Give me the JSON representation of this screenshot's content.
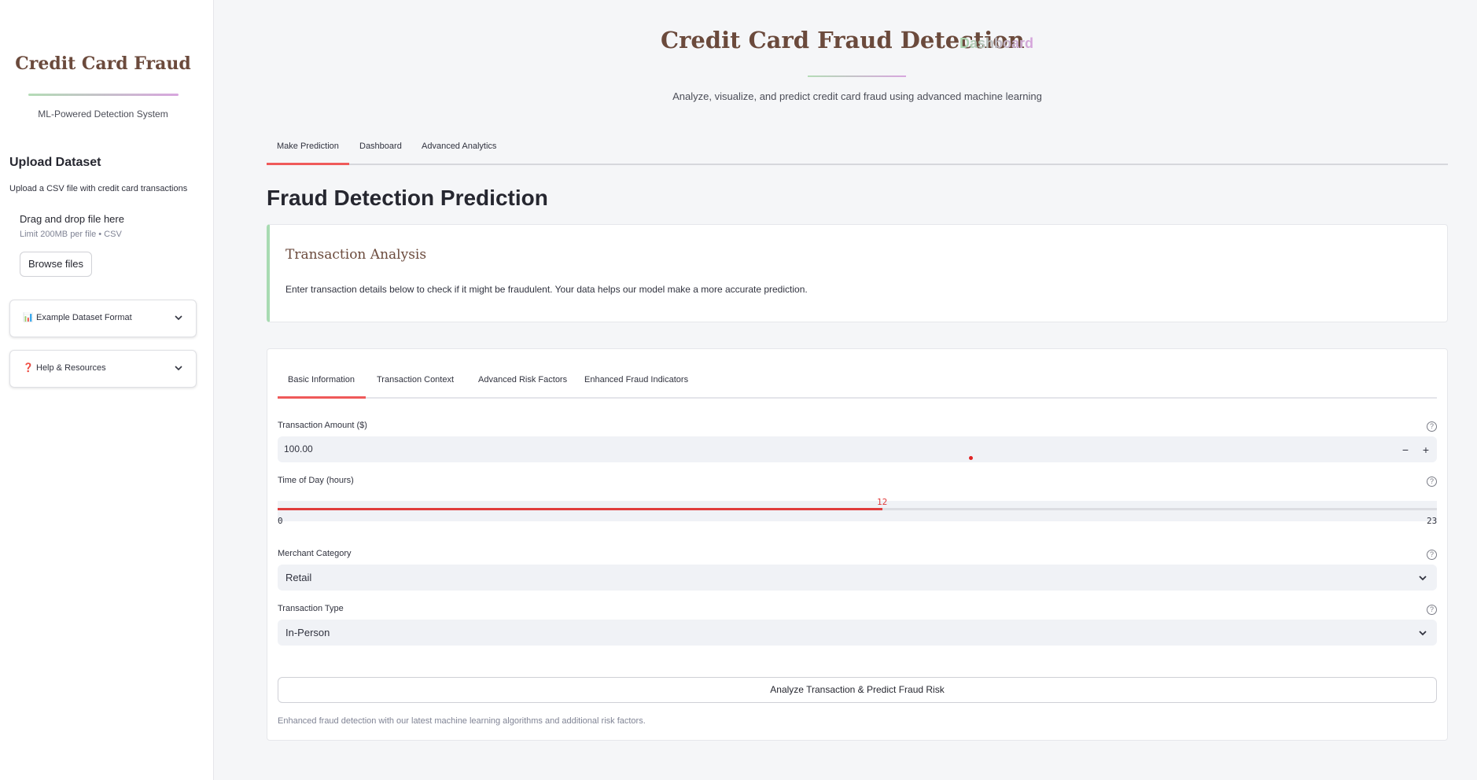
{
  "sidebar": {
    "title": "Credit Card Fraud",
    "subtitle": "ML-Powered Detection System",
    "upload_heading": "Upload Dataset",
    "upload_desc": "Upload a CSV file with credit card transactions",
    "drop_title": "Drag and drop file here",
    "drop_limit": "Limit 200MB per file • CSV",
    "browse_label": "Browse files",
    "expanders": [
      {
        "icon": "📊",
        "label": "Example Dataset Format"
      },
      {
        "icon": "❓",
        "label": "Help & Resources"
      }
    ]
  },
  "header": {
    "title": "Credit Card Fraud Detection",
    "badge": "Dashboard",
    "subtitle": "Analyze, visualize, and predict credit card fraud using advanced machine learning"
  },
  "main_tabs": [
    "Make Prediction",
    "Dashboard",
    "Advanced Analytics"
  ],
  "page_heading": "Fraud Detection Prediction",
  "analysis_card": {
    "heading": "Transaction Analysis",
    "text": "Enter transaction details below to check if it might be fraudulent. Your data helps our model make a more accurate prediction."
  },
  "form": {
    "tabs": [
      "Basic Information",
      "Transaction Context",
      "Advanced Risk Factors",
      "Enhanced Fraud Indicators"
    ],
    "amount_label": "Transaction Amount ($)",
    "amount_value": "100.00",
    "time_label": "Time of Day (hours)",
    "time_value": 12,
    "time_value_label": "12",
    "time_min": "0",
    "time_max": "23",
    "merchant_label": "Merchant Category",
    "merchant_value": "Retail",
    "type_label": "Transaction Type",
    "type_value": "In-Person",
    "submit_label": "Analyze Transaction & Predict Fraud Risk",
    "footnote": "Enhanced fraud detection with our latest machine learning algorithms and additional risk factors."
  },
  "colors": {
    "accent": "#ef5a5a",
    "brand_brown": "#6b4a3c",
    "green": "#a8dbb2",
    "purple": "#d6a3dc"
  }
}
